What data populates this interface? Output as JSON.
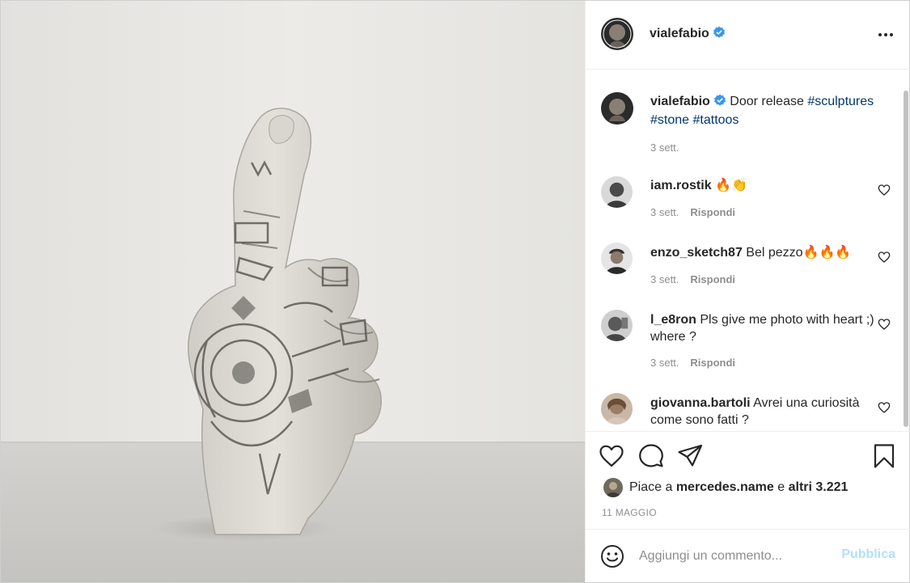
{
  "post": {
    "author": "vialefabio",
    "verified": true,
    "caption_text": "Door release",
    "hashtags": [
      "#sculptures",
      "#stone",
      "#tattoos"
    ],
    "caption_time": "3 sett."
  },
  "comments": [
    {
      "user": "iam.rostik",
      "text": "🔥👏",
      "time": "3 sett.",
      "reply": "Rispondi"
    },
    {
      "user": "enzo_sketch87",
      "text": "Bel pezzo🔥🔥🔥",
      "time": "3 sett.",
      "reply": "Rispondi"
    },
    {
      "user": "l_e8ron",
      "text": "Pls give me photo with heart ;) where ?",
      "time": "3 sett.",
      "reply": "Rispondi"
    },
    {
      "user": "giovanna.bartoli",
      "text": "Avrei una curiosità come sono fatti ?"
    }
  ],
  "likes": {
    "prefix": "Piace a",
    "user": "mercedes.name",
    "conjunction": "e",
    "others": "altri 3.221"
  },
  "date": "11 MAGGIO",
  "composer": {
    "placeholder": "Aggiungi un commento...",
    "publish_label": "Pubblica"
  },
  "icons": {
    "header_menu": "more-horizontal-icon",
    "like": "heart-icon",
    "comment": "comment-bubble-icon",
    "share": "paper-plane-icon",
    "save": "bookmark-icon",
    "emoji": "emoji-smile-icon",
    "verified": "verified-badge-icon"
  },
  "colors": {
    "verified": "#3897f0",
    "hashtag": "#00376b",
    "publish_disabled": "#b2dffc",
    "meta": "#8e8e8e"
  }
}
